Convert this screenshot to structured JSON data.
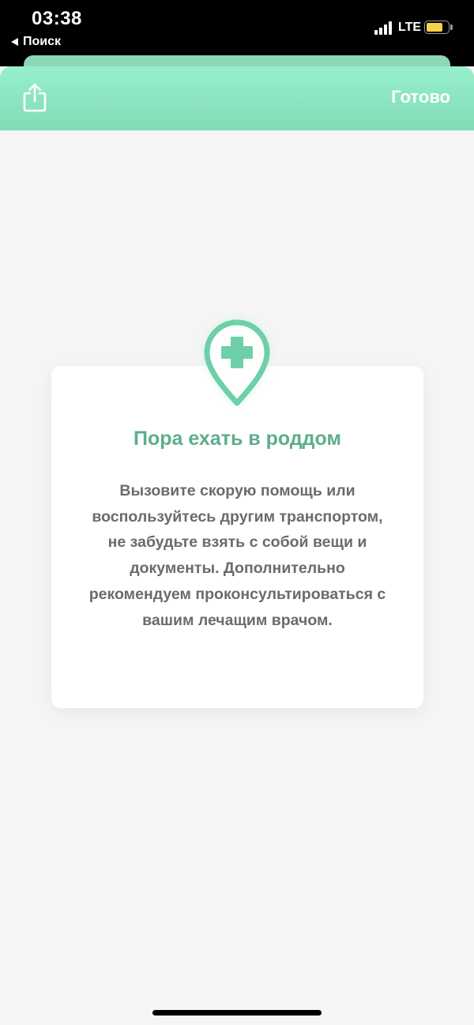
{
  "status_bar": {
    "time": "03:38",
    "back_label": "Поиск",
    "network": "LTE",
    "battery_level": 0.75
  },
  "nav": {
    "done_label": "Готово"
  },
  "card": {
    "title": "Пора ехать в роддом",
    "text": "Вызовите скорую помощь или воспользуйтесь другим транспортом, не забудьте взять с собой вещи и документы. Дополнительно рекомендуем проконсультироваться с вашим лечащим врачом.",
    "icon": "medical-location-pin-icon"
  },
  "colors": {
    "accent": "#6dd0a8",
    "title": "#5cae8c",
    "nav_top": "#97efcc",
    "nav_bottom": "#82dcb6",
    "background": "#f5f5f5"
  }
}
